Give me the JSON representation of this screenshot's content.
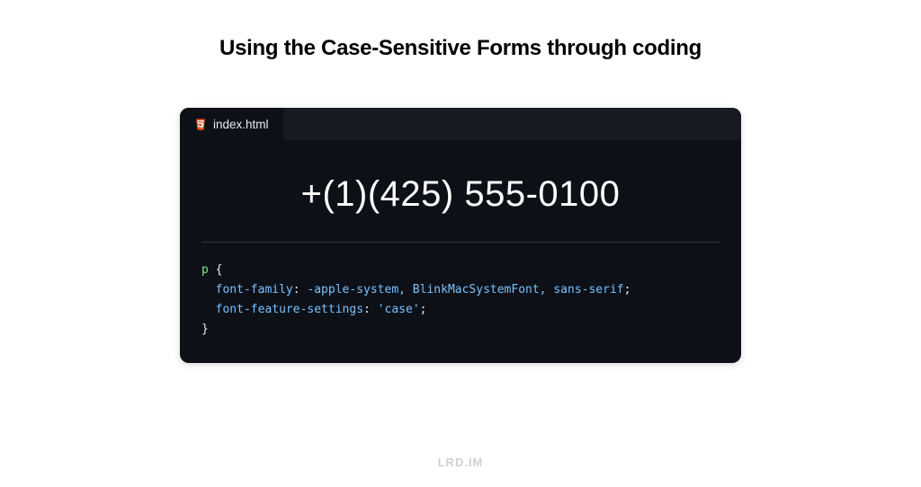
{
  "title": "Using the Case-Sensitive Forms through coding",
  "editor": {
    "tab": {
      "filename": "index.html",
      "icon": "html5-icon"
    },
    "preview_text": "+(1)(425) 555-0100",
    "code": {
      "selector": "p",
      "open_brace": "{",
      "lines": [
        {
          "property": "font-family",
          "value": "-apple-system, BlinkMacSystemFont, sans-serif"
        },
        {
          "property": "font-feature-settings",
          "value": "'case'"
        }
      ],
      "close_brace": "}"
    }
  },
  "watermark": "LRD.IM"
}
